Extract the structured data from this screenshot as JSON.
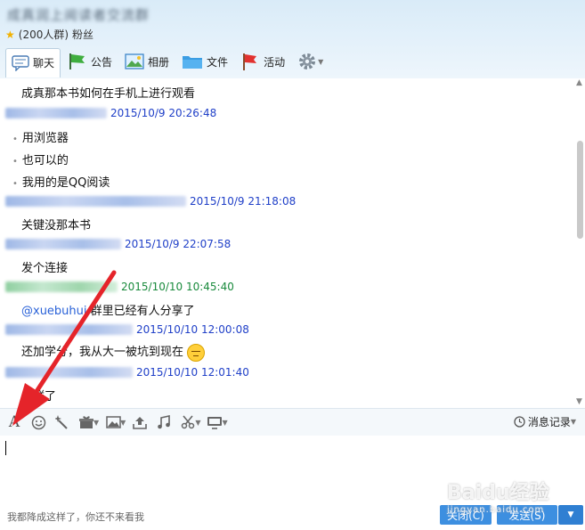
{
  "window": {
    "title": "成真润上阅读者交流群"
  },
  "group_info": {
    "size": "(200人群)",
    "role": "粉丝"
  },
  "tabs": [
    {
      "label": "聊天",
      "icon": "chat-bubble-icon"
    },
    {
      "label": "公告",
      "icon": "flag-green-icon"
    },
    {
      "label": "相册",
      "icon": "photo-icon"
    },
    {
      "label": "文件",
      "icon": "folder-icon"
    },
    {
      "label": "活动",
      "icon": "flag-red-icon"
    }
  ],
  "messages": {
    "m1": {
      "text": "成真那本书如何在手机上进行观看"
    },
    "t1": {
      "time": "2015/10/9 20:26:48"
    },
    "m2": {
      "text": "用浏览器"
    },
    "m3": {
      "text": "也可以的"
    },
    "m4": {
      "text": "我用的是QQ阅读"
    },
    "t2": {
      "time": "2015/10/9 21:18:08"
    },
    "m5": {
      "text": "关键没那本书"
    },
    "t3": {
      "time": "2015/10/9 22:07:58"
    },
    "m6": {
      "text": "发个连接"
    },
    "t4": {
      "time": "2015/10/10 10:45:40"
    },
    "m7": {
      "mention": "@xuebuhui",
      "text": " 群里已经有人分享了"
    },
    "t5": {
      "time": "2015/10/10 12:00:08"
    },
    "m8": {
      "text": "还加学分，我从大一被坑到现在"
    },
    "t6": {
      "time": "2015/10/10 12:01:40"
    },
    "m9": {
      "text": "发群了"
    }
  },
  "toolbar": {
    "history_label": "消息记录"
  },
  "input": {
    "hint": "我都降成这样了，你还不来看我"
  },
  "buttons": {
    "close": "关闭(C)",
    "send": "发送(S)"
  },
  "watermark": {
    "brand": "Baidu经验",
    "url": "jingyan.baidu.com"
  },
  "colors": {
    "timestamp_blue": "#2040c8",
    "timestamp_green": "#198a3c",
    "button_blue": "#3d8fe0",
    "arrow_red": "#e5242a"
  }
}
